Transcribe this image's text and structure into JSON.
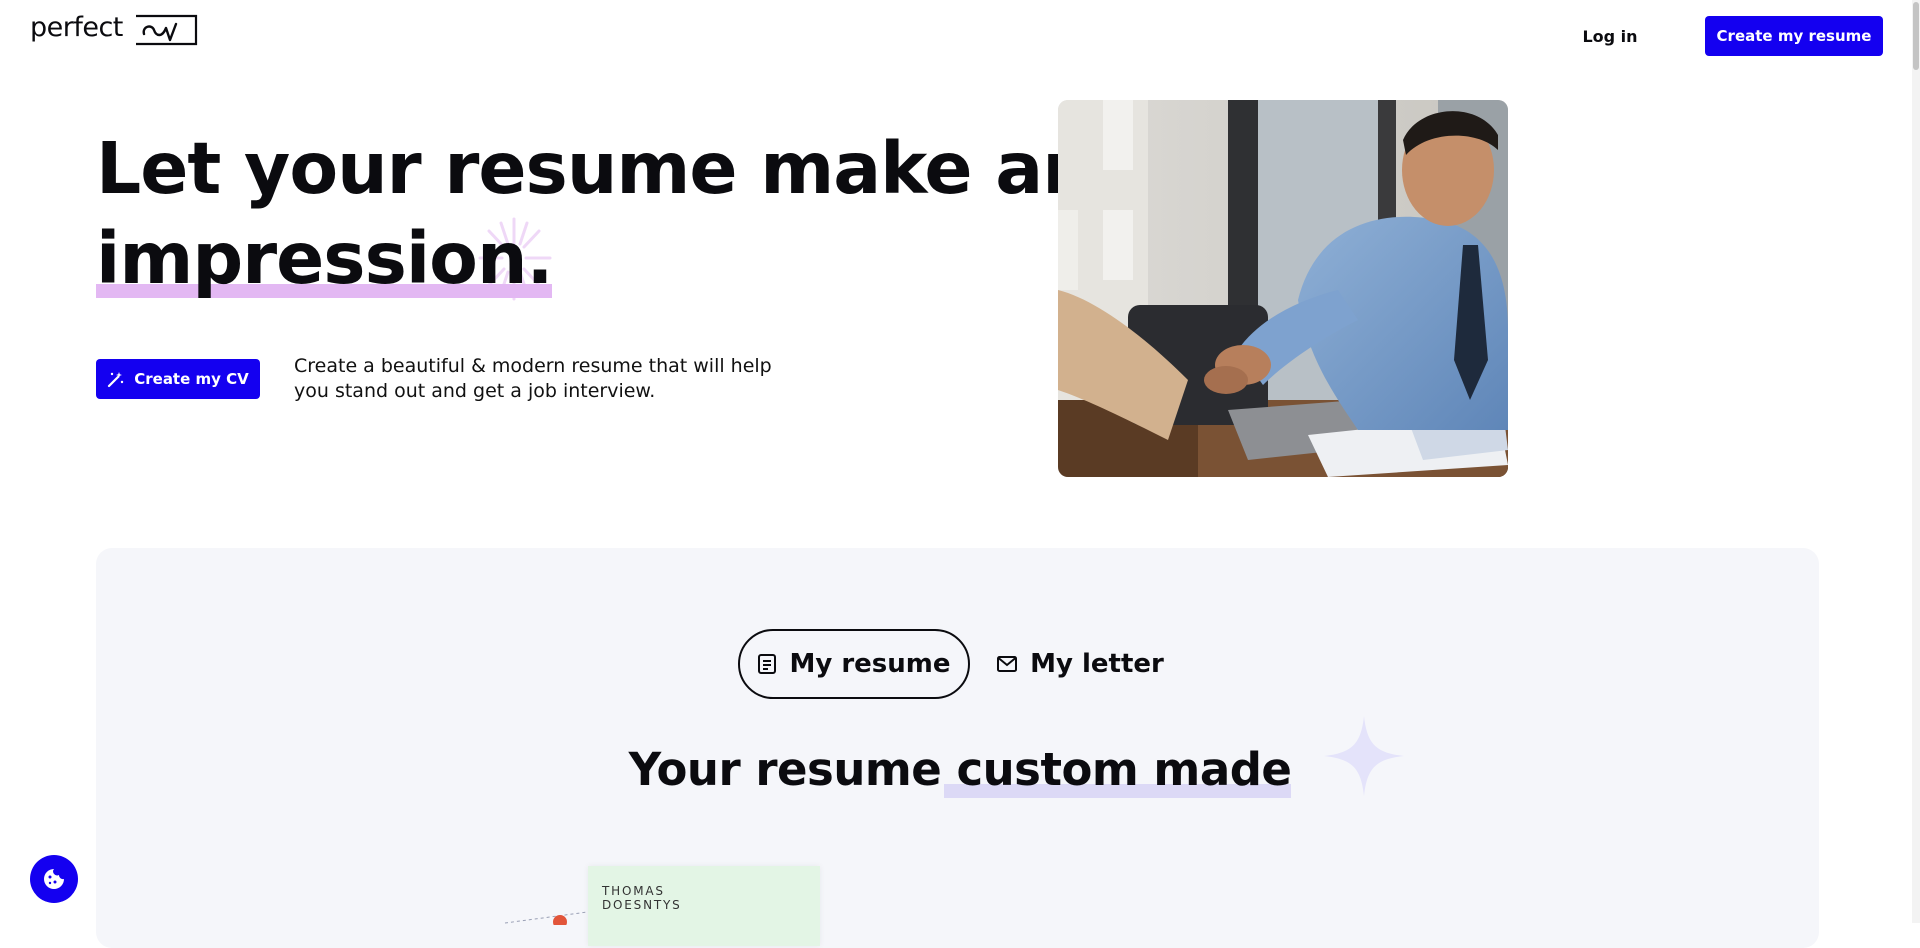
{
  "header": {
    "logo_text": "perfect",
    "logo_mark_text": "cv",
    "login_label": "Log in",
    "cta_label": "Create my resume"
  },
  "hero": {
    "title_line1": "Let your resume make an",
    "title_line2": "impression.",
    "cta_label": "Create my CV",
    "description": "Create a beautiful & modern resume that will help you stand out and get a job interview."
  },
  "section": {
    "tabs": [
      {
        "label": "My resume",
        "icon": "document-icon",
        "active": true
      },
      {
        "label": "My letter",
        "icon": "envelope-icon",
        "active": false
      }
    ],
    "title_plain": "Your resume",
    "title_highlight": "custom made"
  },
  "resume_preview": {
    "first_name": "THOMAS",
    "last_name": "DOESNTYS"
  },
  "colors": {
    "accent": "#1400f0",
    "highlight_purple": "#e3b8f3",
    "highlight_lavender": "#dcd9f6",
    "section_bg": "#f5f6fa",
    "resume_card_bg": "#e3f5e5"
  }
}
